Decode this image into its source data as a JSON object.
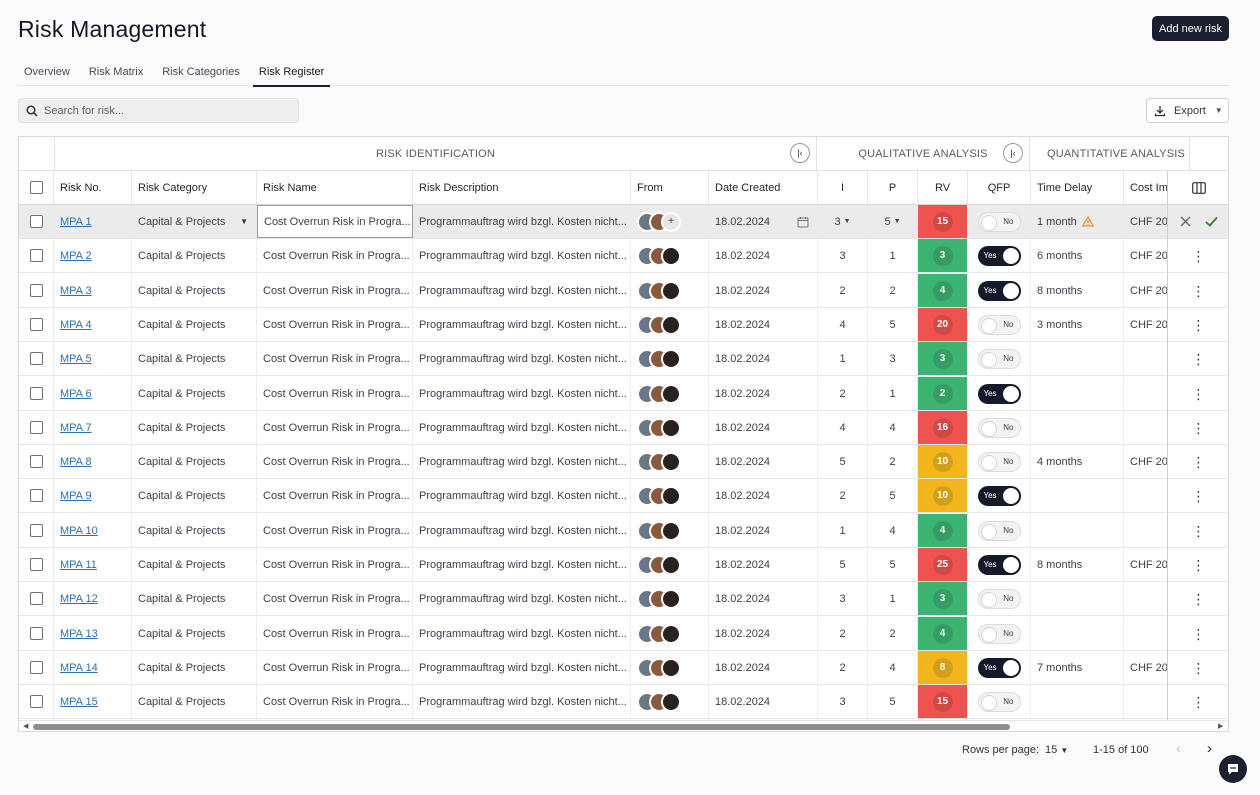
{
  "page": {
    "title": "Risk Management",
    "add_button": "Add new risk"
  },
  "tabs": [
    {
      "label": "Overview",
      "active": false
    },
    {
      "label": "Risk Matrix",
      "active": false
    },
    {
      "label": "Risk Categories",
      "active": false
    },
    {
      "label": "Risk Register",
      "active": true
    }
  ],
  "search": {
    "placeholder": "Search for risk..."
  },
  "export": {
    "label": "Export"
  },
  "groups": {
    "identification": "RISK IDENTIFICATION",
    "qualitative": "QUALITATIVE ANALYSIS",
    "quantitative": "QUANTITATIVE ANALYSIS"
  },
  "columns": {
    "risk_no": "Risk No.",
    "category": "Risk Category",
    "name": "Risk Name",
    "description": "Risk Description",
    "from": "From",
    "date": "Date Created",
    "i": "I",
    "p": "P",
    "rv": "RV",
    "qfp": "QFP",
    "time_delay": "Time Delay",
    "cost_impact": "Cost Impact"
  },
  "colors": {
    "rv_red": "#ef5350",
    "rv_green": "#3cb371",
    "rv_yellow": "#f2b51c",
    "accent_dark": "#1a2030",
    "link": "#2d6fb0"
  },
  "rows": [
    {
      "no": "MPA 1",
      "category": "Capital & Projects",
      "name": "Cost Overrun Risk in Progra...",
      "desc": "Programmauftrag wird bzgl. Kosten nicht...",
      "date": "18.02.2024",
      "i": "3",
      "p": "5",
      "rv": "15",
      "rv_level": "red",
      "qfp": "No",
      "time": "1 month",
      "cost": "CHF 20"
    },
    {
      "no": "MPA 2",
      "category": "Capital & Projects",
      "name": "Cost Overrun Risk in Progra...",
      "desc": "Programmauftrag wird bzgl. Kosten nicht...",
      "date": "18.02.2024",
      "i": "3",
      "p": "1",
      "rv": "3",
      "rv_level": "green",
      "qfp": "Yes",
      "time": "6 months",
      "cost": "CHF 20"
    },
    {
      "no": "MPA 3",
      "category": "Capital & Projects",
      "name": "Cost Overrun Risk in Progra...",
      "desc": "Programmauftrag wird bzgl. Kosten nicht...",
      "date": "18.02.2024",
      "i": "2",
      "p": "2",
      "rv": "4",
      "rv_level": "green",
      "qfp": "Yes",
      "time": "8 months",
      "cost": "CHF 20"
    },
    {
      "no": "MPA 4",
      "category": "Capital & Projects",
      "name": "Cost Overrun Risk in Progra...",
      "desc": "Programmauftrag wird bzgl. Kosten nicht...",
      "date": "18.02.2024",
      "i": "4",
      "p": "5",
      "rv": "20",
      "rv_level": "red",
      "qfp": "No",
      "time": "3 months",
      "cost": "CHF 20"
    },
    {
      "no": "MPA 5",
      "category": "Capital & Projects",
      "name": "Cost Overrun Risk in Progra...",
      "desc": "Programmauftrag wird bzgl. Kosten nicht...",
      "date": "18.02.2024",
      "i": "1",
      "p": "3",
      "rv": "3",
      "rv_level": "green",
      "qfp": "No",
      "time": "",
      "cost": ""
    },
    {
      "no": "MPA 6",
      "category": "Capital & Projects",
      "name": "Cost Overrun Risk in Progra...",
      "desc": "Programmauftrag wird bzgl. Kosten nicht...",
      "date": "18.02.2024",
      "i": "2",
      "p": "1",
      "rv": "2",
      "rv_level": "green",
      "qfp": "Yes",
      "time": "",
      "cost": ""
    },
    {
      "no": "MPA 7",
      "category": "Capital & Projects",
      "name": "Cost Overrun Risk in Progra...",
      "desc": "Programmauftrag wird bzgl. Kosten nicht...",
      "date": "18.02.2024",
      "i": "4",
      "p": "4",
      "rv": "16",
      "rv_level": "red",
      "qfp": "No",
      "time": "",
      "cost": ""
    },
    {
      "no": "MPA 8",
      "category": "Capital & Projects",
      "name": "Cost Overrun Risk in Progra...",
      "desc": "Programmauftrag wird bzgl. Kosten nicht...",
      "date": "18.02.2024",
      "i": "5",
      "p": "2",
      "rv": "10",
      "rv_level": "yellow",
      "qfp": "No",
      "time": "4 months",
      "cost": "CHF 20"
    },
    {
      "no": "MPA 9",
      "category": "Capital & Projects",
      "name": "Cost Overrun Risk in Progra...",
      "desc": "Programmauftrag wird bzgl. Kosten nicht...",
      "date": "18.02.2024",
      "i": "2",
      "p": "5",
      "rv": "10",
      "rv_level": "yellow",
      "qfp": "Yes",
      "time": "",
      "cost": ""
    },
    {
      "no": "MPA 10",
      "category": "Capital & Projects",
      "name": "Cost Overrun Risk in Progra...",
      "desc": "Programmauftrag wird bzgl. Kosten nicht...",
      "date": "18.02.2024",
      "i": "1",
      "p": "4",
      "rv": "4",
      "rv_level": "green",
      "qfp": "No",
      "time": "",
      "cost": ""
    },
    {
      "no": "MPA 11",
      "category": "Capital & Projects",
      "name": "Cost Overrun Risk in Progra...",
      "desc": "Programmauftrag wird bzgl. Kosten nicht...",
      "date": "18.02.2024",
      "i": "5",
      "p": "5",
      "rv": "25",
      "rv_level": "red",
      "qfp": "Yes",
      "time": "8 months",
      "cost": "CHF 20"
    },
    {
      "no": "MPA 12",
      "category": "Capital & Projects",
      "name": "Cost Overrun Risk in Progra...",
      "desc": "Programmauftrag wird bzgl. Kosten nicht...",
      "date": "18.02.2024",
      "i": "3",
      "p": "1",
      "rv": "3",
      "rv_level": "green",
      "qfp": "No",
      "time": "",
      "cost": ""
    },
    {
      "no": "MPA 13",
      "category": "Capital & Projects",
      "name": "Cost Overrun Risk in Progra...",
      "desc": "Programmauftrag wird bzgl. Kosten nicht...",
      "date": "18.02.2024",
      "i": "2",
      "p": "2",
      "rv": "4",
      "rv_level": "green",
      "qfp": "No",
      "time": "",
      "cost": ""
    },
    {
      "no": "MPA 14",
      "category": "Capital & Projects",
      "name": "Cost Overrun Risk in Progra...",
      "desc": "Programmauftrag wird bzgl. Kosten nicht...",
      "date": "18.02.2024",
      "i": "2",
      "p": "4",
      "rv": "8",
      "rv_level": "yellow",
      "qfp": "Yes",
      "time": "7 months",
      "cost": "CHF 20"
    },
    {
      "no": "MPA 15",
      "category": "Capital & Projects",
      "name": "Cost Overrun Risk in Progra...",
      "desc": "Programmauftrag wird bzgl. Kosten nicht...",
      "date": "18.02.2024",
      "i": "3",
      "p": "5",
      "rv": "15",
      "rv_level": "red",
      "qfp": "No",
      "time": "",
      "cost": ""
    }
  ],
  "pagination": {
    "rows_per_page_label": "Rows per page:",
    "rows_per_page": "15",
    "range": "1-15 of 100"
  },
  "icons": [
    "search-icon",
    "download-icon",
    "collapse-left-icon",
    "columns-icon",
    "calendar-icon",
    "warning-icon",
    "close-icon",
    "check-icon",
    "kebab-icon",
    "add-person-icon",
    "chat-icon"
  ]
}
